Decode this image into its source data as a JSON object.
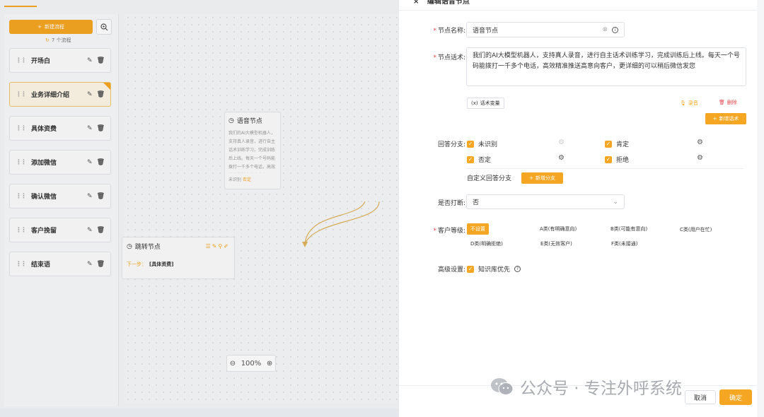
{
  "sidebar": {
    "new_flow_label": "新建流程",
    "flow_count": "7 个流程",
    "items": [
      {
        "label": "开场白"
      },
      {
        "label": "业务详细介绍"
      },
      {
        "label": "具体资费"
      },
      {
        "label": "添加微信"
      },
      {
        "label": "确认微信"
      },
      {
        "label": "客户挽留"
      },
      {
        "label": "结束语"
      }
    ]
  },
  "canvas": {
    "voice_node": {
      "title": "语音节点",
      "excerpt": "我们的AI大模型机器人，支持真人录音，进行自主话术训练学习，完成训练后上线。每天一个号码能拨打一千多个电话，高效精准推送高意向客户，更详细的可以稍后微信发您",
      "footer_a": "未识别",
      "footer_b": "否定"
    },
    "jump_node": {
      "title": "跳转节点",
      "next_label": "下一步：",
      "next_target": "[具体资费]"
    },
    "zoom": "100%"
  },
  "drawer": {
    "title": "编辑语音节点",
    "node_name_label": "节点名称:",
    "node_name_value": "语音节点",
    "script_label": "节点话术:",
    "script_value": "我们的AI大模型机器人，支持真人录音，进行自主话术训练学习，完成训练后上线。每天一个号码能拨打一千多个电话，高效精准推送高意向客户，更详细的可以稍后微信发您",
    "script_var_label": "话术变量",
    "record_label": "录音",
    "delete_label": "删除",
    "add_script_label": "新增话术",
    "branch_label": "回答分支:",
    "branches": [
      {
        "label": "未识别",
        "checked": true
      },
      {
        "label": "肯定",
        "checked": true
      },
      {
        "label": "否定",
        "checked": true
      },
      {
        "label": "拒绝",
        "checked": true
      }
    ],
    "custom_branch_label": "自定义回答分支",
    "add_branch_label": "新增分支",
    "interrupt_label": "是否打断:",
    "interrupt_value": "否",
    "grade_label": "客户等级:",
    "grades": [
      {
        "label": "不设置",
        "selected": true
      },
      {
        "label": "A类(有明确意向)",
        "selected": false
      },
      {
        "label": "B类(可能有意向)",
        "selected": false
      },
      {
        "label": "C类(用户在忙)",
        "selected": false
      },
      {
        "label": "D类(明确拒绝)",
        "selected": false
      },
      {
        "label": "E类(无效客户)",
        "selected": false
      },
      {
        "label": "F类(未接通)",
        "selected": false
      }
    ],
    "advanced_label": "高级设置:",
    "kb_priority_label": "知识库优先",
    "cancel_label": "取消",
    "ok_label": "确定"
  },
  "watermark": "公众号 · 专注外呼系统",
  "colors": {
    "accent": "#f5a623",
    "danger": "#e5484d",
    "border": "#dcdfe4"
  }
}
